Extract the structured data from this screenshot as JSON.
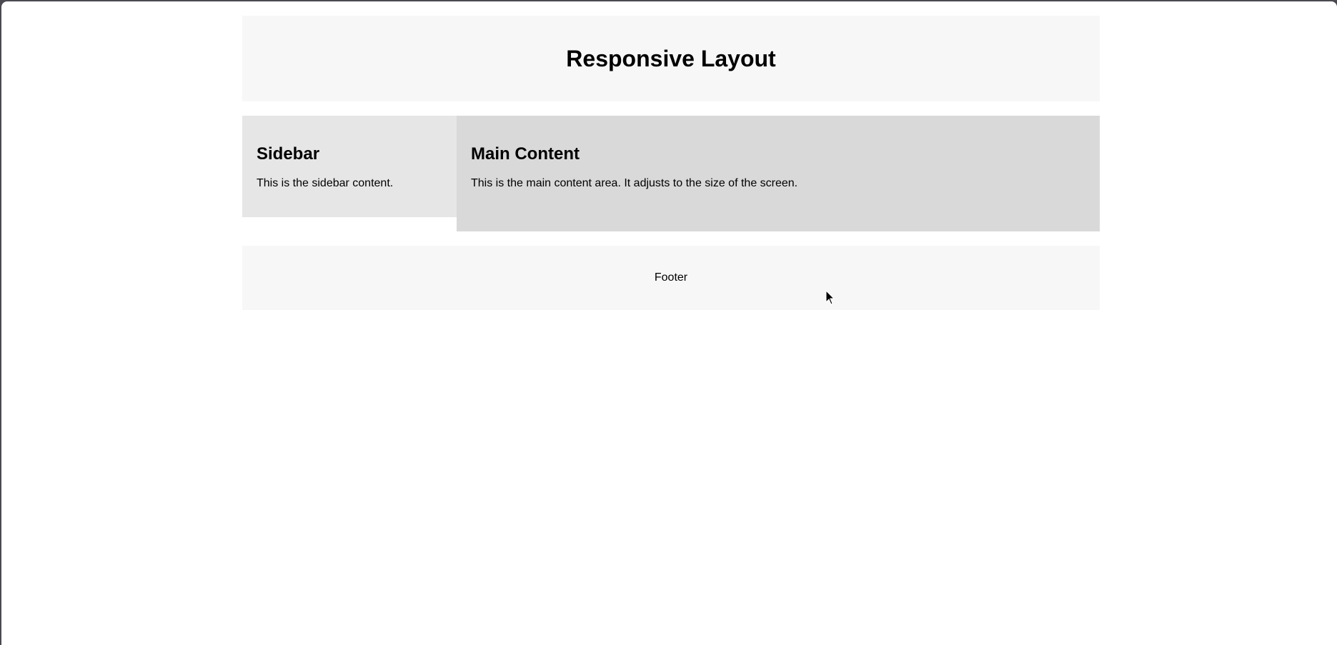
{
  "header": {
    "title": "Responsive Layout"
  },
  "sidebar": {
    "title": "Sidebar",
    "text": "This is the sidebar content."
  },
  "main": {
    "title": "Main Content",
    "text": "This is the main content area. It adjusts to the size of the screen."
  },
  "footer": {
    "text": "Footer"
  },
  "colors": {
    "header_bg": "#f7f7f7",
    "sidebar_bg": "#e6e6e6",
    "main_bg": "#d9d9d9",
    "footer_bg": "#f7f7f7"
  }
}
